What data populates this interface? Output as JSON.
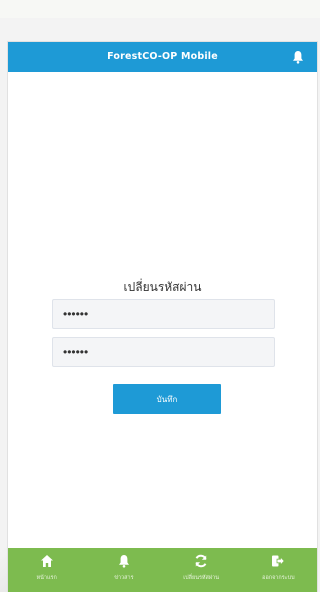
{
  "header": {
    "title": "ForestCO-OP Mobile"
  },
  "form": {
    "title": "เปลี่ยนรหัสผ่าน",
    "password": "123456",
    "confirm_password": "123456",
    "save_label": "บันทึก"
  },
  "tabbar": {
    "items": [
      {
        "label": "หน้าแรก",
        "icon": "home-icon"
      },
      {
        "label": "ข่าวสาร",
        "icon": "bell-icon"
      },
      {
        "label": "เปลี่ยนรหัสผ่าน",
        "icon": "refresh-icon"
      },
      {
        "label": "ออกจากระบบ",
        "icon": "logout-icon"
      }
    ]
  },
  "colors": {
    "header": "#1e9ad6",
    "button": "#1e9ad6",
    "tabbar": "#7dbb4f"
  }
}
